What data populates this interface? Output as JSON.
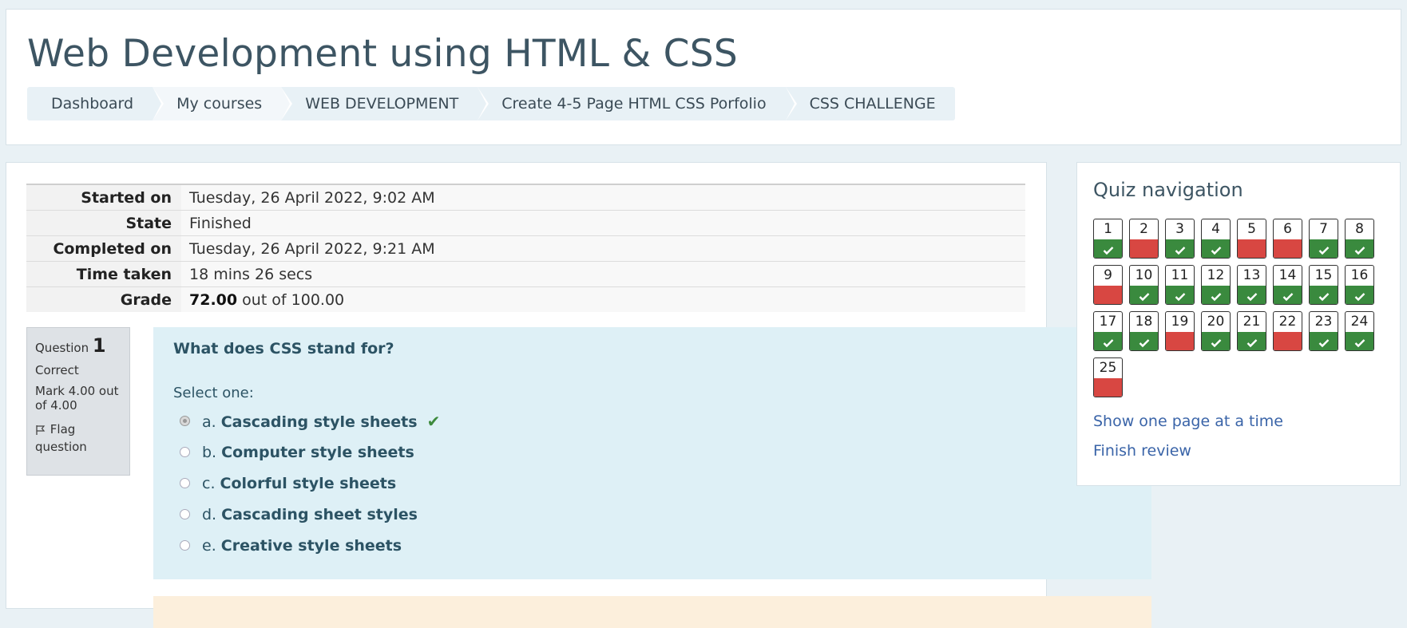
{
  "header": {
    "title": "Web Development using HTML & CSS",
    "breadcrumb": [
      "Dashboard",
      "My courses",
      "WEB DEVELOPMENT",
      "Create 4-5 Page HTML CSS Porfolio",
      "CSS CHALLENGE"
    ]
  },
  "summary": {
    "started_label": "Started on",
    "started_value": "Tuesday, 26 April 2022, 9:02 AM",
    "state_label": "State",
    "state_value": "Finished",
    "completed_label": "Completed on",
    "completed_value": "Tuesday, 26 April 2022, 9:21 AM",
    "time_label": "Time taken",
    "time_value": "18 mins 26 secs",
    "grade_label": "Grade",
    "grade_score": "72.00",
    "grade_rest": "out of 100.00"
  },
  "question": {
    "label": "Question",
    "number": "1",
    "status": "Correct",
    "mark": "Mark 4.00 out of 4.00",
    "flag": "Flag question",
    "text": "What does CSS stand for?",
    "prompt": "Select one:",
    "answers": [
      {
        "letter": "a.",
        "text": "Cascading style sheets"
      },
      {
        "letter": "b.",
        "text": "Computer style sheets"
      },
      {
        "letter": "c.",
        "text": "Colorful style sheets"
      },
      {
        "letter": "d.",
        "text": "Cascading sheet styles"
      },
      {
        "letter": "e.",
        "text": "Creative style sheets"
      }
    ],
    "selected_answer": "a.",
    "correct_answer": "a.",
    "check_icon_color": "#3d8a3d"
  },
  "quiz_nav": {
    "title": "Quiz navigation",
    "questions": [
      {
        "n": "1",
        "state": "correct"
      },
      {
        "n": "2",
        "state": "incorrect"
      },
      {
        "n": "3",
        "state": "correct"
      },
      {
        "n": "4",
        "state": "correct"
      },
      {
        "n": "5",
        "state": "incorrect"
      },
      {
        "n": "6",
        "state": "incorrect"
      },
      {
        "n": "7",
        "state": "correct"
      },
      {
        "n": "8",
        "state": "correct"
      },
      {
        "n": "9",
        "state": "incorrect"
      },
      {
        "n": "10",
        "state": "correct"
      },
      {
        "n": "11",
        "state": "correct"
      },
      {
        "n": "12",
        "state": "correct"
      },
      {
        "n": "13",
        "state": "correct"
      },
      {
        "n": "14",
        "state": "correct"
      },
      {
        "n": "15",
        "state": "correct"
      },
      {
        "n": "16",
        "state": "correct"
      },
      {
        "n": "17",
        "state": "correct"
      },
      {
        "n": "18",
        "state": "correct"
      },
      {
        "n": "19",
        "state": "incorrect"
      },
      {
        "n": "20",
        "state": "correct"
      },
      {
        "n": "21",
        "state": "correct"
      },
      {
        "n": "22",
        "state": "incorrect"
      },
      {
        "n": "23",
        "state": "correct"
      },
      {
        "n": "24",
        "state": "correct"
      },
      {
        "n": "25",
        "state": "incorrect"
      }
    ],
    "show_one_page": "Show one page at a time",
    "finish_review": "Finish review",
    "colors": {
      "correct": "#3a8a3e",
      "incorrect": "#d84742",
      "link": "#3a64a8"
    }
  }
}
